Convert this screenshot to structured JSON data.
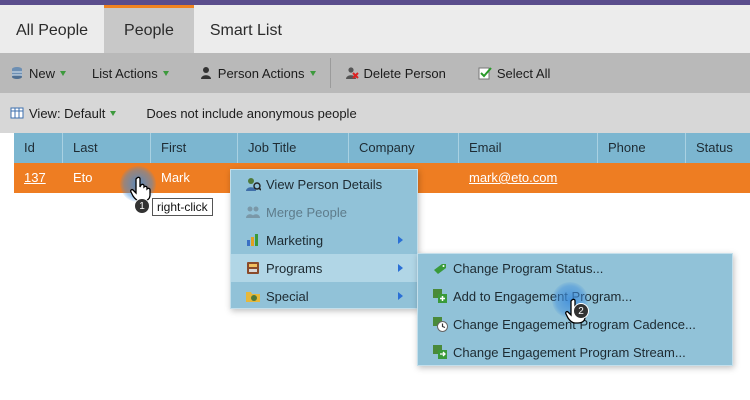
{
  "tabs": [
    {
      "label": "All People"
    },
    {
      "label": "People"
    },
    {
      "label": "Smart List"
    }
  ],
  "toolbar": {
    "new_label": "New",
    "list_actions_label": "List Actions",
    "person_actions_label": "Person Actions",
    "delete_person_label": "Delete Person",
    "select_all_label": "Select All"
  },
  "viewbar": {
    "view_label": "View: Default",
    "note": "Does not include anonymous people"
  },
  "grid": {
    "columns": [
      "Id",
      "Last",
      "First",
      "Job Title",
      "Company",
      "Email",
      "Phone",
      "Status"
    ],
    "row": {
      "id": "137",
      "last": "Eto",
      "first": "Mark",
      "job_title": "",
      "company": "",
      "email": "mark@eto.com",
      "phone": "",
      "status": ""
    }
  },
  "context_menu": {
    "items": [
      {
        "label": "View Person Details",
        "icon": "person-details-icon"
      },
      {
        "label": "Merge People",
        "icon": "merge-icon"
      },
      {
        "label": "Marketing",
        "icon": "marketing-icon"
      },
      {
        "label": "Programs",
        "icon": "programs-icon"
      },
      {
        "label": "Special",
        "icon": "special-icon"
      }
    ]
  },
  "programs_submenu": {
    "items": [
      {
        "label": "Change Program Status..."
      },
      {
        "label": "Add to Engagement Program..."
      },
      {
        "label": "Change Engagement Program Cadence..."
      },
      {
        "label": "Change Engagement Program Stream..."
      }
    ]
  },
  "annotations": {
    "step1_number": "1",
    "step1_text": "right-click",
    "step2_number": "2"
  },
  "colors": {
    "accent_orange": "#ee7d22",
    "header_blue": "#7cb6d0",
    "menu_blue": "#91c2d8",
    "top_purple": "#5a4d8c"
  }
}
